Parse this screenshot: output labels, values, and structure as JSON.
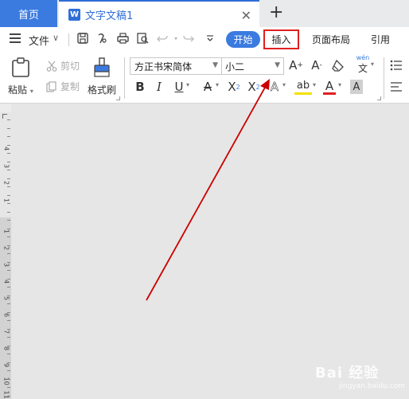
{
  "tabs": {
    "home": "首页",
    "doc_icon": "W",
    "doc_title": "文字文稿1",
    "close": "✕",
    "add": "+"
  },
  "menu": {
    "file": "文件",
    "file_caret": "∨",
    "tab_start": "开始",
    "tab_insert": "插入",
    "tab_layout": "页面布局",
    "tab_reference": "引用"
  },
  "ribbon": {
    "paste": "粘贴",
    "cut": "剪切",
    "copy": "复制",
    "format_painter": "格式刷",
    "font_name": "方正书宋简体",
    "font_size": "小二",
    "bold": "B",
    "italic": "I",
    "underline": "U",
    "strikethrough": "A",
    "superscript": "X",
    "subscript": "X",
    "text_effect": "A",
    "highlight": "ab",
    "font_color": "A",
    "char_shading": "A",
    "grow_font": "A",
    "shrink_font": "A",
    "phonetic": "wén"
  },
  "ruler_numbers": [
    "4",
    "3",
    "2",
    "1",
    "1",
    "2",
    "3",
    "4",
    "5",
    "6",
    "7",
    "8",
    "9",
    "10",
    "11"
  ],
  "watermark": {
    "main": "Bai 经验",
    "sub": "jingyan.baidu.com"
  },
  "colors": {
    "accent": "#3b7be0",
    "highlight_box": "#e02020",
    "arrow": "#cc0000"
  },
  "icons": [
    "save-icon",
    "export-icon",
    "print-icon",
    "print-preview-icon",
    "undo-icon",
    "redo-icon",
    "customize-icon",
    "clipboard-icon",
    "scissors-icon",
    "copy-icon",
    "paintbrush-icon",
    "eraser-icon",
    "bullet-list-icon",
    "align-icon"
  ]
}
